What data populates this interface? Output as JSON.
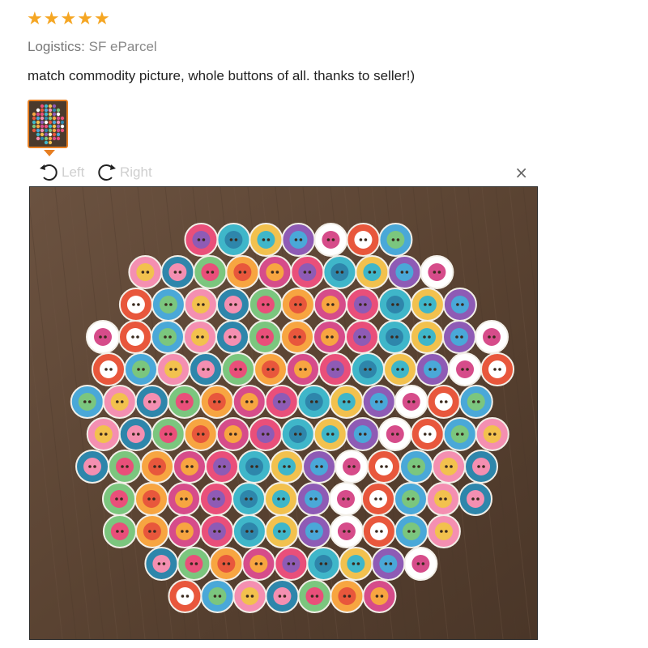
{
  "review": {
    "stars": [
      "★",
      "★",
      "★",
      "★",
      "★"
    ],
    "rating": 5,
    "star_color": "#f5a623",
    "logistics_label": "Logistics:",
    "logistics_value": "SF eParcel",
    "text": "match commodity picture, whole buttons of all. thanks to seller!)"
  },
  "viewer": {
    "rotate_left_label": "Left",
    "rotate_right_label": "Right",
    "close_symbol": "×",
    "thumbnail_icon": "photo-thumbnail",
    "accent_color": "#e67e22"
  }
}
